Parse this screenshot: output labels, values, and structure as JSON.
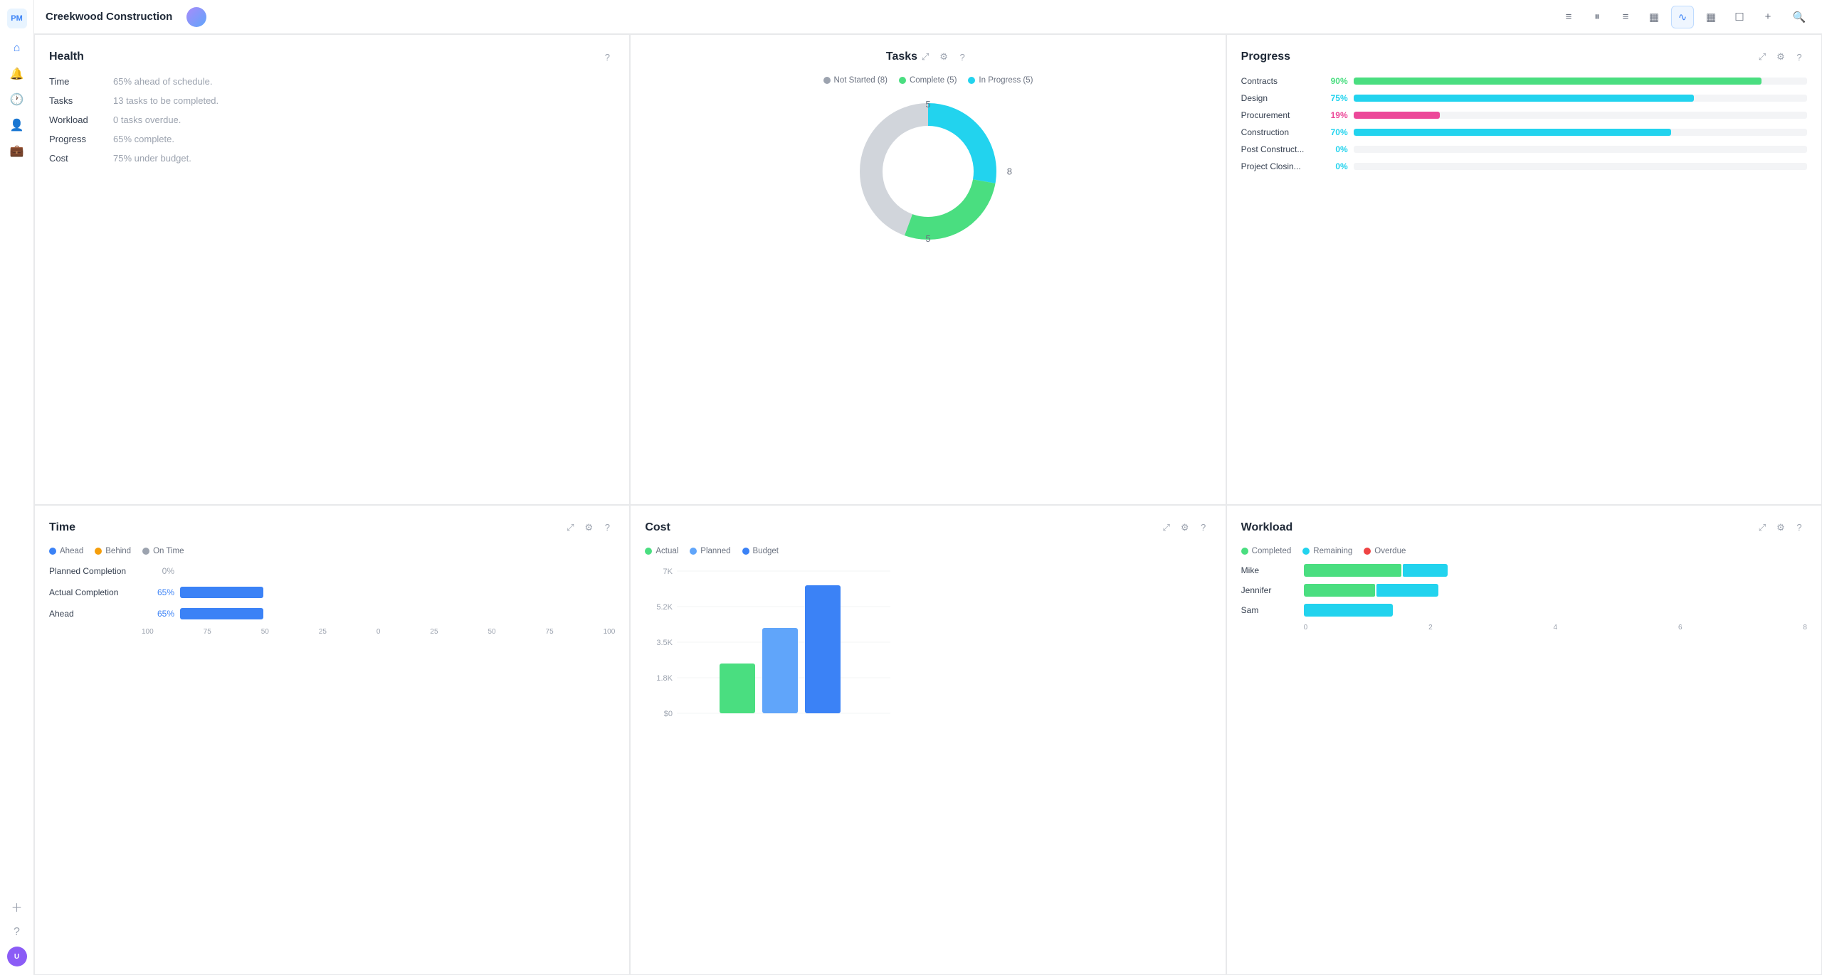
{
  "app": {
    "logo": "PM"
  },
  "topbar": {
    "title": "Creekwood Construction",
    "icons": [
      "≡",
      "⏸",
      "≡",
      "▦",
      "∿",
      "▦",
      "☐",
      "+"
    ],
    "active_icon_index": 4
  },
  "health": {
    "title": "Health",
    "rows": [
      {
        "label": "Time",
        "value": "65% ahead of schedule."
      },
      {
        "label": "Tasks",
        "value": "13 tasks to be completed."
      },
      {
        "label": "Workload",
        "value": "0 tasks overdue."
      },
      {
        "label": "Progress",
        "value": "65% complete."
      },
      {
        "label": "Cost",
        "value": "75% under budget."
      }
    ]
  },
  "tasks": {
    "title": "Tasks",
    "legend": [
      {
        "label": "Not Started (8)",
        "color": "#9ca3af"
      },
      {
        "label": "Complete (5)",
        "color": "#4ade80"
      },
      {
        "label": "In Progress (5)",
        "color": "#22d3ee"
      }
    ],
    "donut": {
      "not_started": 8,
      "complete": 5,
      "in_progress": 5,
      "label_top": "5",
      "label_right": "8",
      "label_bottom": "5"
    }
  },
  "progress": {
    "title": "Progress",
    "rows": [
      {
        "category": "Contracts",
        "pct": 90,
        "pct_label": "90%",
        "color": "#4ade80"
      },
      {
        "category": "Design",
        "pct": 75,
        "pct_label": "75%",
        "color": "#22d3ee"
      },
      {
        "category": "Procurement",
        "pct": 19,
        "pct_label": "19%",
        "color": "#ec4899"
      },
      {
        "category": "Construction",
        "pct": 70,
        "pct_label": "70%",
        "color": "#22d3ee"
      },
      {
        "category": "Post Construct...",
        "pct": 0,
        "pct_label": "0%",
        "color": "#22d3ee"
      },
      {
        "category": "Project Closin...",
        "pct": 0,
        "pct_label": "0%",
        "color": "#22d3ee"
      }
    ]
  },
  "time": {
    "title": "Time",
    "legend": [
      {
        "label": "Ahead",
        "color": "#3b82f6"
      },
      {
        "label": "Behind",
        "color": "#f59e0b"
      },
      {
        "label": "On Time",
        "color": "#9ca3af"
      }
    ],
    "rows": [
      {
        "label": "Planned Completion",
        "pct_label": "0%",
        "value": 0,
        "color": "#3b82f6",
        "show_pct": true
      },
      {
        "label": "Actual Completion",
        "pct_label": "65%",
        "value": 65,
        "color": "#3b82f6",
        "show_pct": true
      },
      {
        "label": "Ahead",
        "pct_label": "65%",
        "value": 65,
        "color": "#3b82f6",
        "show_pct": true
      }
    ],
    "x_axis": [
      "100",
      "75",
      "50",
      "25",
      "0",
      "25",
      "50",
      "75",
      "100"
    ]
  },
  "cost": {
    "title": "Cost",
    "legend": [
      {
        "label": "Actual",
        "color": "#4ade80"
      },
      {
        "label": "Planned",
        "color": "#60a5fa"
      },
      {
        "label": "Budget",
        "color": "#3b82f6"
      }
    ],
    "y_axis": [
      "7K",
      "5.2K",
      "3.5K",
      "1.8K",
      "$0"
    ],
    "bars": [
      {
        "actual": 35,
        "planned": 60,
        "budget": 90
      }
    ],
    "colors": {
      "actual": "#4ade80",
      "planned": "#60a5fa",
      "budget": "#3b82f6"
    }
  },
  "workload": {
    "title": "Workload",
    "legend": [
      {
        "label": "Completed",
        "color": "#4ade80"
      },
      {
        "label": "Remaining",
        "color": "#22d3ee"
      },
      {
        "label": "Overdue",
        "color": "#ef4444"
      }
    ],
    "rows": [
      {
        "name": "Mike",
        "completed": 55,
        "remaining": 25,
        "overdue": 0
      },
      {
        "name": "Jennifer",
        "completed": 40,
        "remaining": 35,
        "overdue": 0
      },
      {
        "name": "Sam",
        "completed": 0,
        "remaining": 50,
        "overdue": 0
      }
    ],
    "x_axis": [
      "0",
      "2",
      "4",
      "6",
      "8"
    ]
  },
  "icons": {
    "expand": "⤢",
    "gear": "⚙",
    "question": "?",
    "search": "🔍",
    "plus": "+"
  }
}
